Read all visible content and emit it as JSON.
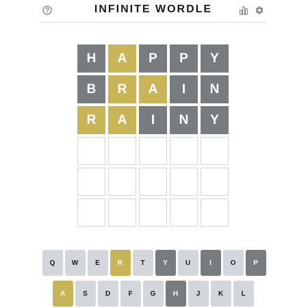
{
  "header": {
    "title": "INFINITE WORDLE",
    "help_icon": "help-circle-icon",
    "stats_icon": "bar-chart-icon",
    "settings_icon": "gear-icon"
  },
  "colors": {
    "absent": "#787c7e",
    "present": "#c9b458",
    "correct": "#6aaa64",
    "empty_border": "#d3d6da",
    "key_default": "#d3d6da"
  },
  "board": {
    "rows": [
      [
        {
          "letter": "H",
          "state": "absent"
        },
        {
          "letter": "A",
          "state": "present"
        },
        {
          "letter": "P",
          "state": "absent"
        },
        {
          "letter": "P",
          "state": "absent"
        },
        {
          "letter": "Y",
          "state": "absent"
        }
      ],
      [
        {
          "letter": "B",
          "state": "absent"
        },
        {
          "letter": "R",
          "state": "present"
        },
        {
          "letter": "A",
          "state": "present"
        },
        {
          "letter": "I",
          "state": "absent"
        },
        {
          "letter": "N",
          "state": "absent"
        }
      ],
      [
        {
          "letter": "R",
          "state": "present"
        },
        {
          "letter": "A",
          "state": "present"
        },
        {
          "letter": "I",
          "state": "absent"
        },
        {
          "letter": "N",
          "state": "absent"
        },
        {
          "letter": "Y",
          "state": "absent"
        }
      ],
      [
        {
          "letter": "",
          "state": "empty"
        },
        {
          "letter": "",
          "state": "empty"
        },
        {
          "letter": "",
          "state": "empty"
        },
        {
          "letter": "",
          "state": "empty"
        },
        {
          "letter": "",
          "state": "empty"
        }
      ],
      [
        {
          "letter": "",
          "state": "empty"
        },
        {
          "letter": "",
          "state": "empty"
        },
        {
          "letter": "",
          "state": "empty"
        },
        {
          "letter": "",
          "state": "empty"
        },
        {
          "letter": "",
          "state": "empty"
        }
      ],
      [
        {
          "letter": "",
          "state": "empty"
        },
        {
          "letter": "",
          "state": "empty"
        },
        {
          "letter": "",
          "state": "empty"
        },
        {
          "letter": "",
          "state": "empty"
        },
        {
          "letter": "",
          "state": "empty"
        }
      ]
    ]
  },
  "keyboard": {
    "rows": [
      [
        {
          "label": "Q",
          "state": "unused"
        },
        {
          "label": "W",
          "state": "unused"
        },
        {
          "label": "E",
          "state": "unused"
        },
        {
          "label": "R",
          "state": "present"
        },
        {
          "label": "T",
          "state": "unused"
        },
        {
          "label": "Y",
          "state": "absent"
        },
        {
          "label": "U",
          "state": "unused"
        },
        {
          "label": "I",
          "state": "absent"
        },
        {
          "label": "O",
          "state": "unused"
        },
        {
          "label": "P",
          "state": "absent"
        }
      ],
      [
        {
          "label": "A",
          "state": "present"
        },
        {
          "label": "S",
          "state": "unused"
        },
        {
          "label": "D",
          "state": "unused"
        },
        {
          "label": "F",
          "state": "unused"
        },
        {
          "label": "G",
          "state": "unused"
        },
        {
          "label": "H",
          "state": "absent"
        },
        {
          "label": "J",
          "state": "unused"
        },
        {
          "label": "K",
          "state": "unused"
        },
        {
          "label": "L",
          "state": "unused"
        }
      ]
    ]
  }
}
